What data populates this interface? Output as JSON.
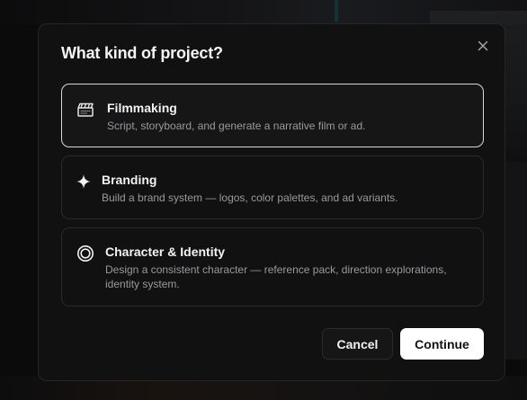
{
  "modal": {
    "title": "What kind of project?",
    "close_icon": "close-icon"
  },
  "options": [
    {
      "icon": "clapperboard-icon",
      "title": "Filmmaking",
      "description": "Script, storyboard, and generate a narrative film or ad.",
      "selected": true
    },
    {
      "icon": "sparkle-icon",
      "title": "Branding",
      "description": "Build a brand system — logos, color palettes, and ad variants.",
      "selected": false
    },
    {
      "icon": "target-circle-icon",
      "title": "Character & Identity",
      "description": "Design a consistent character — reference pack, direction explorations, identity system.",
      "selected": false
    }
  ],
  "footer": {
    "cancel_label": "Cancel",
    "continue_label": "Continue"
  },
  "colors": {
    "modal_bg": "#111112",
    "border": "#2a2a2c",
    "selected_border": "#d8d8d8",
    "primary_button": "#ffffff"
  }
}
